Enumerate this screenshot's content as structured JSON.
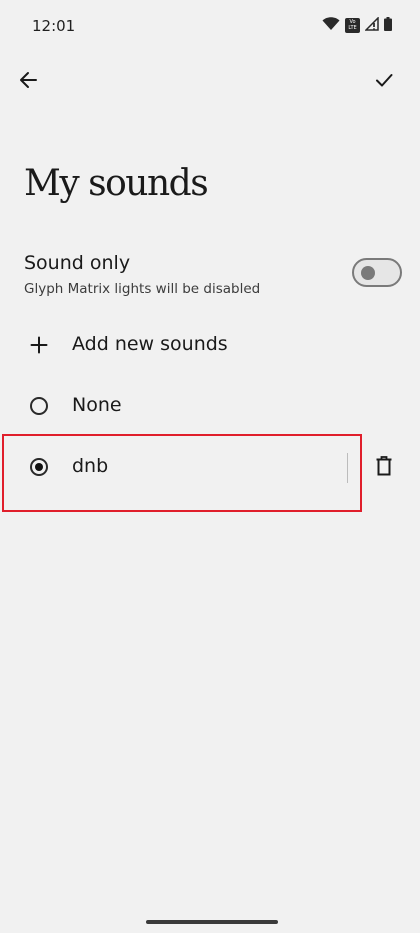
{
  "status_bar": {
    "time": "12:01",
    "volte_line1": "Vo",
    "volte_line2": "LTE",
    "icons": [
      "wifi-icon",
      "volte-icon",
      "cellular-signal-icon",
      "battery-icon"
    ]
  },
  "top_bar": {
    "back_icon": "arrow-left-icon",
    "confirm_icon": "check-icon"
  },
  "page": {
    "title": "My sounds"
  },
  "sound_only": {
    "title": "Sound only",
    "subtitle": "Glyph Matrix lights will be disabled",
    "enabled": false
  },
  "list": {
    "add_label": "Add new sounds",
    "items": [
      {
        "label": "None",
        "selected": false
      },
      {
        "label": "dnb",
        "selected": true
      }
    ]
  },
  "colors": {
    "background": "#f1f1f1",
    "highlight": "#e01e2b",
    "text": "#1a1a1a"
  }
}
